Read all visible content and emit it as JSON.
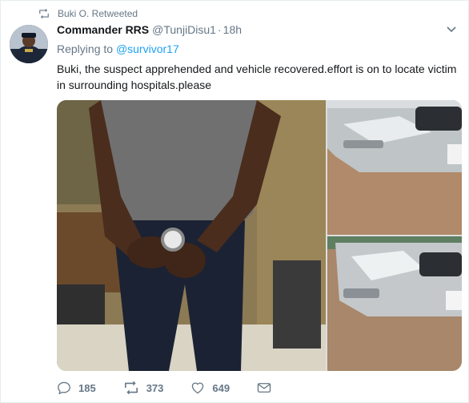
{
  "retweet": {
    "label": "Buki O. Retweeted"
  },
  "author": {
    "name": "Commander RRS",
    "handle": "@TunjiDisu1",
    "separator": "·",
    "time": "18h"
  },
  "reply": {
    "prefix": "Replying to ",
    "to": "@survivor17"
  },
  "tweet_text": "Buki, the suspect apprehended and vehicle recovered.effort is on to locate victim in surrounding hospitals.please",
  "actions": {
    "replies": "185",
    "retweets": "373",
    "likes": "649"
  },
  "colors": {
    "link": "#1da1f2",
    "muted": "#657786",
    "text": "#14171a"
  },
  "media": {
    "photos": [
      {
        "subject": "man-in-grey-shirt-photo"
      },
      {
        "subject": "car-front-photo-top"
      },
      {
        "subject": "car-front-photo-bottom"
      }
    ]
  }
}
